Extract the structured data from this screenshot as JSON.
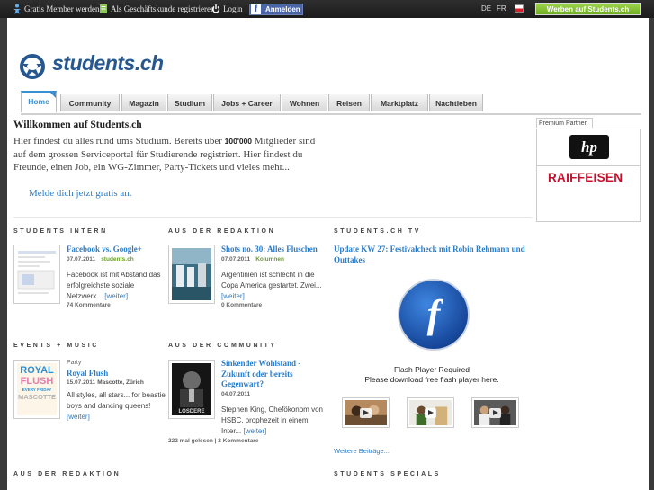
{
  "topbar": {
    "member": "Gratis Member werden",
    "business": "Als Geschäftskunde registrieren",
    "login": "Login",
    "facebook_icon": "f",
    "facebook": "Anmelden",
    "lang_de": "DE",
    "lang_fr": "FR",
    "werben": "Werben auf Students.ch"
  },
  "logo": {
    "text": "students.ch"
  },
  "nav": {
    "tabs": [
      {
        "label": "Home"
      },
      {
        "label": "Community"
      },
      {
        "label": "Magazin"
      },
      {
        "label": "Studium"
      },
      {
        "label": "Jobs + Career"
      },
      {
        "label": "Wohnen"
      },
      {
        "label": "Reisen"
      },
      {
        "label": "Marktplatz"
      },
      {
        "label": "Nachtleben"
      }
    ]
  },
  "welcome": {
    "title": "Willkommen auf Students.ch",
    "text_before": "Hier findest du alles rund ums Studium. Bereits über ",
    "count": "100'000",
    "text_after": " Mitglieder sind auf dem grossen Serviceportal für Studierende registriert. Hier findest du Freunde, einen Job, ein WG-Zimmer, Party-Tickets und vieles mehr...",
    "signup": "Melde dich jetzt gratis an."
  },
  "partner": {
    "label": "Premium Partner",
    "hp": "hp",
    "raiffeisen": "RAIFFEISEN"
  },
  "sections": {
    "intern": {
      "title": "STUDENTS INTERN",
      "article": {
        "title": "Facebook vs. Google+",
        "date": "07.07.2011",
        "source": "students.ch",
        "text": "Facebook ist mit Abstand das erfolgreichste soziale Netzwerk...",
        "more": "[weiter]",
        "comments": "74 Kommentare"
      }
    },
    "redaktion": {
      "title": "AUS DER REDAKTION",
      "article": {
        "title": "Shots no. 30: Alles Fluschen",
        "date": "07.07.2011",
        "source": "Kolumnen",
        "text": "Argentinien ist schlecht in die Copa America gestartet. Zwei...",
        "more": "[weiter]",
        "comments": "0 Kommentare"
      }
    },
    "tv": {
      "title": "STUDENTS.CH TV",
      "article": {
        "title": "Update KW 27: Festivalcheck mit Robin Rehmann und Outtakes"
      },
      "flash_icon": "f",
      "flash_required": "Flash Player Required",
      "flash_download": "Please download free flash player here.",
      "more": "Weitere Beiträge..."
    },
    "events": {
      "title": "EVENTS + MUSIC",
      "article": {
        "category": "Party",
        "title": "Royal Flush",
        "date": "15.07.2011",
        "location": "Mascotte, Zürich",
        "text": "All styles, all stars... for beastie boys and dancing queens!",
        "more": "[weiter]",
        "thumb_line1": "ROYAL",
        "thumb_line2": "FLUSH",
        "thumb_line3": "EVERY FRIDAY",
        "thumb_line4": "MASCOTTE"
      }
    },
    "community": {
      "title": "AUS DER COMMUNITY",
      "article": {
        "title": "Sinkender Wohlstand - Zukunft oder bereits Gegenwart?",
        "date": "04.07.2011",
        "text": "Stephen King, Chefökonom von HSBC, prophezeit in einem Inter...",
        "more": "[weiter]",
        "stats": "222 mal gelesen | 2 Kommentare",
        "thumb_text": "LOSDERE"
      }
    },
    "redaktion2": {
      "title": "AUS DER REDAKTION"
    },
    "specials": {
      "title": "STUDENTS SPECIALS"
    }
  }
}
